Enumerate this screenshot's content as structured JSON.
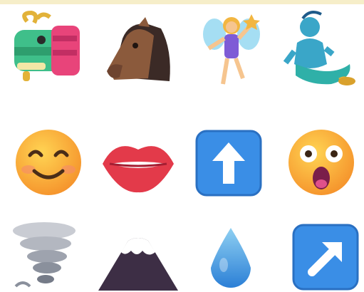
{
  "emoji_grid": {
    "rows": [
      [
        "dragon-face",
        "horse-face",
        "woman-fairy",
        "man-genie"
      ],
      [
        "smiling-face-with-smiling-eyes",
        "mouth",
        "up-arrow-button",
        "face-with-open-mouth"
      ],
      [
        "tornado",
        "mount-fuji",
        "droplet",
        "up-right-arrow-button"
      ]
    ]
  },
  "colors": {
    "accent_strip": "#f6eec9",
    "background": "#ffffff",
    "button_blue": "#3a8ee6",
    "face_yellow": "#fbb62e"
  }
}
